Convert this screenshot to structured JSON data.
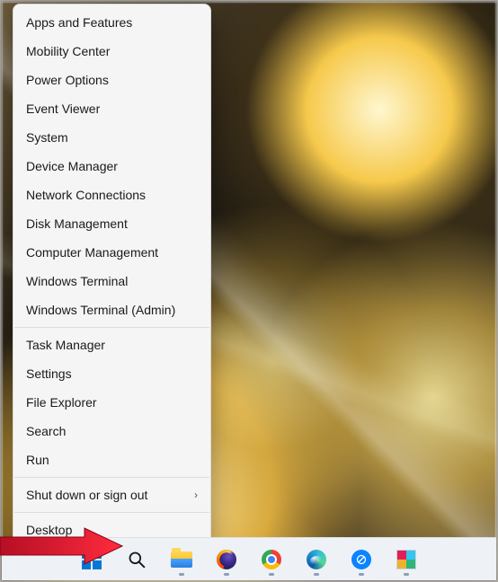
{
  "menu": {
    "groups": [
      [
        {
          "label": "Apps and Features",
          "name": "menu-apps-and-features"
        },
        {
          "label": "Mobility Center",
          "name": "menu-mobility-center"
        },
        {
          "label": "Power Options",
          "name": "menu-power-options"
        },
        {
          "label": "Event Viewer",
          "name": "menu-event-viewer"
        },
        {
          "label": "System",
          "name": "menu-system"
        },
        {
          "label": "Device Manager",
          "name": "menu-device-manager"
        },
        {
          "label": "Network Connections",
          "name": "menu-network-connections"
        },
        {
          "label": "Disk Management",
          "name": "menu-disk-management"
        },
        {
          "label": "Computer Management",
          "name": "menu-computer-management"
        },
        {
          "label": "Windows Terminal",
          "name": "menu-windows-terminal"
        },
        {
          "label": "Windows Terminal (Admin)",
          "name": "menu-windows-terminal-admin"
        }
      ],
      [
        {
          "label": "Task Manager",
          "name": "menu-task-manager"
        },
        {
          "label": "Settings",
          "name": "menu-settings"
        },
        {
          "label": "File Explorer",
          "name": "menu-file-explorer"
        },
        {
          "label": "Search",
          "name": "menu-search"
        },
        {
          "label": "Run",
          "name": "menu-run"
        }
      ],
      [
        {
          "label": "Shut down or sign out",
          "name": "menu-shutdown-signout",
          "submenu": true
        }
      ],
      [
        {
          "label": "Desktop",
          "name": "menu-desktop"
        }
      ]
    ]
  },
  "taskbar": {
    "items": [
      {
        "name": "start-button",
        "icon": "windows-logo-icon"
      },
      {
        "name": "search-button",
        "icon": "search-icon"
      },
      {
        "name": "file-explorer-button",
        "icon": "file-explorer-icon"
      },
      {
        "name": "firefox-button",
        "icon": "firefox-icon"
      },
      {
        "name": "chrome-button",
        "icon": "chrome-icon"
      },
      {
        "name": "edge-button",
        "icon": "edge-icon"
      },
      {
        "name": "app-blue-button",
        "icon": "circle-slash-icon"
      },
      {
        "name": "app-grid-button",
        "icon": "grid-app-icon"
      }
    ]
  },
  "annotation": {
    "arrow_color": "#E8112D"
  }
}
